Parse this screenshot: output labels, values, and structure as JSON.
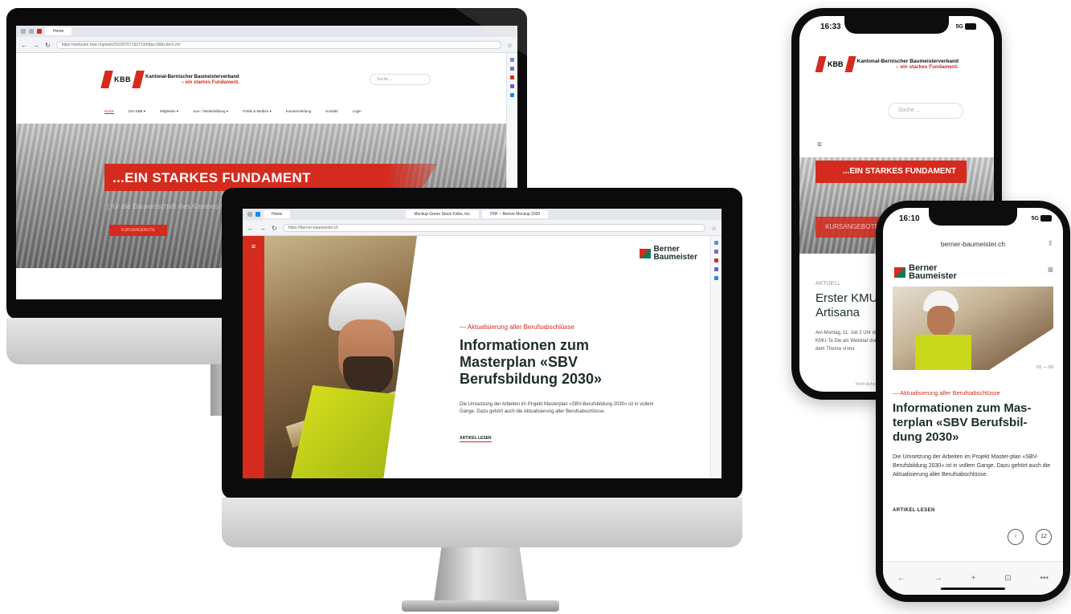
{
  "monitor1": {
    "tab_title": "Home",
    "url": "https://webcam.hive.org/web/20230707193713/https://kbb-bern.ch/",
    "logo_mark": "KBB",
    "logo_name": "Kantonal-Bernischer Baumeisterverband",
    "logo_sub": "– ein starkes Fundament.",
    "search_placeholder": "Suche ...",
    "nav": [
      "Home",
      "Der KBB ▾",
      "Mitglieder ▾",
      "Aus- / Weiterbildung ▾",
      "Politik & Medien ▾",
      "Kursanmeldung",
      "Kontakt",
      "Login"
    ],
    "hero_title": "...EIN STARKES FUNDAMENT",
    "hero_ghost": "[ für die Bauwirtschaft des Kantons Bern ]",
    "hero_button": "KURSANGEBOTE"
  },
  "monitor2": {
    "tabs": [
      "Home",
      "Mockup Green Stock Folks, Inc.",
      "PDF – Berner Mockup 2020"
    ],
    "url": "https://berner-baumeister.ch",
    "logo_line1": "Berner",
    "logo_line2": "Baumeister",
    "kicker": "— Aktualisierung aller Berufsabschlüsse",
    "title": "Informationen zum Masterplan «SBV Berufsbildung 2030»",
    "text": "Die Umsetzung der Arbeiten im Projekt Masterplan «SBV-Berufsbildung 2030» ist in vollem Gange. Dazu gehört auch die Aktualisierung aller Berufsabschlüsse.",
    "link": "ARTIKEL LESEN"
  },
  "phone1": {
    "time": "16:33",
    "signal": "5G",
    "logo_mark": "KBB",
    "logo_name": "Kantonal-Bernischer Baumeisterverband",
    "logo_sub": "– ein starkes Fundament.",
    "search_placeholder": "Suche ...",
    "menu_icon": "≡",
    "hero_title": "...EIN STARKES FUNDAMENT",
    "hero_button": "KURSANGEBOTE",
    "kicker": "AKTUELL",
    "headline": "Erster KMU-Tag Artisana",
    "body": "Am Montag, 11. Juli 2 Uhr der erste KMU-Ta Die als Webinar durch sich dem Thema «Inno",
    "footer": "Nicht sicher —"
  },
  "phone2": {
    "time": "16:10",
    "signal": "5G",
    "url": "berner-baumeister.ch",
    "logo_line1": "Berner",
    "logo_line2": "Baumeister",
    "counter": "01 — 03",
    "kicker": "— Aktualisierung aller Berufsabschlüsse",
    "title": "Informationen zum Mas-terplan «SBV Berufsbil-dung 2030»",
    "text": "Die Umsetzung der Arbeiten im Projekt Master-plan «SBV-Berufsbildung 2030» ist in vollem Gange. Dazu gehört auch die Aktualisierung aller Berufsabschlüsse.",
    "link": "ARTIKEL LESEN",
    "prev": "‹",
    "page": "12",
    "toolbar": [
      "←",
      "→",
      "+",
      "⊡",
      "•••"
    ]
  },
  "colors": {
    "brand_red": "#d52b1e",
    "dark_green": "#1c2e2a",
    "accent_green": "#0f7a5a"
  }
}
